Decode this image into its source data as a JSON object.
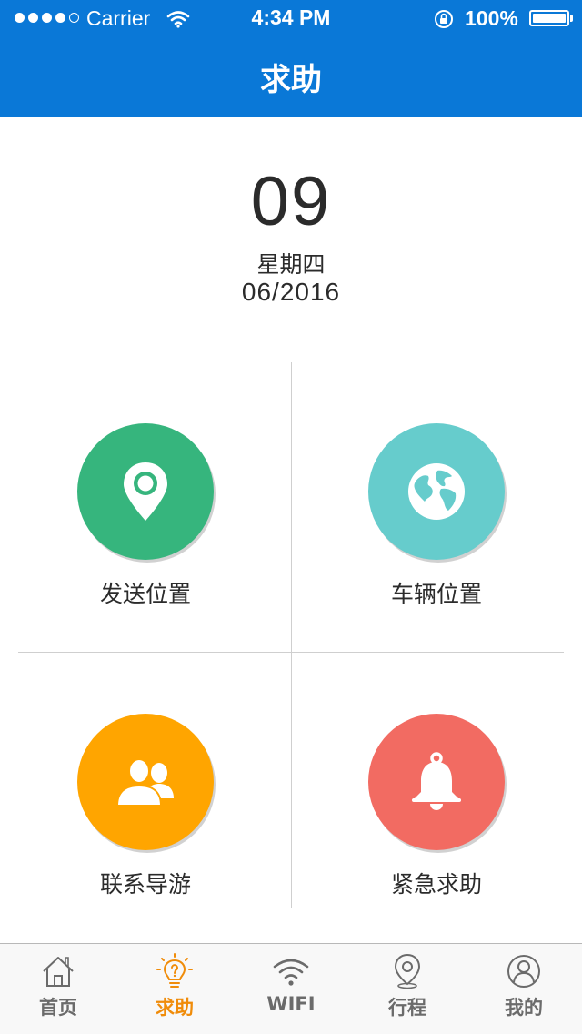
{
  "status_bar": {
    "carrier": "Carrier",
    "time": "4:34 PM",
    "battery": "100%"
  },
  "nav": {
    "title": "求助"
  },
  "date": {
    "day": "09",
    "weekday": "星期四",
    "month_year": "06/2016"
  },
  "actions": [
    {
      "label": "发送位置",
      "icon": "location-pin-icon",
      "color": "#36b57d"
    },
    {
      "label": "车辆位置",
      "icon": "globe-icon",
      "color": "#66cccc"
    },
    {
      "label": "联系导游",
      "icon": "contacts-icon",
      "color": "#ffa500"
    },
    {
      "label": "紧急求助",
      "icon": "bell-icon",
      "color": "#f26b62"
    }
  ],
  "tabbar": {
    "active_color": "#f08c0a",
    "inactive_color": "#6b6b6b",
    "tabs": [
      {
        "label": "首页",
        "icon": "home-icon"
      },
      {
        "label": "求助",
        "icon": "lightbulb-help-icon",
        "active": true
      },
      {
        "label": "WIFI",
        "icon": "wifi-icon"
      },
      {
        "label": "行程",
        "icon": "map-pin-icon"
      },
      {
        "label": "我的",
        "icon": "user-icon"
      }
    ]
  }
}
